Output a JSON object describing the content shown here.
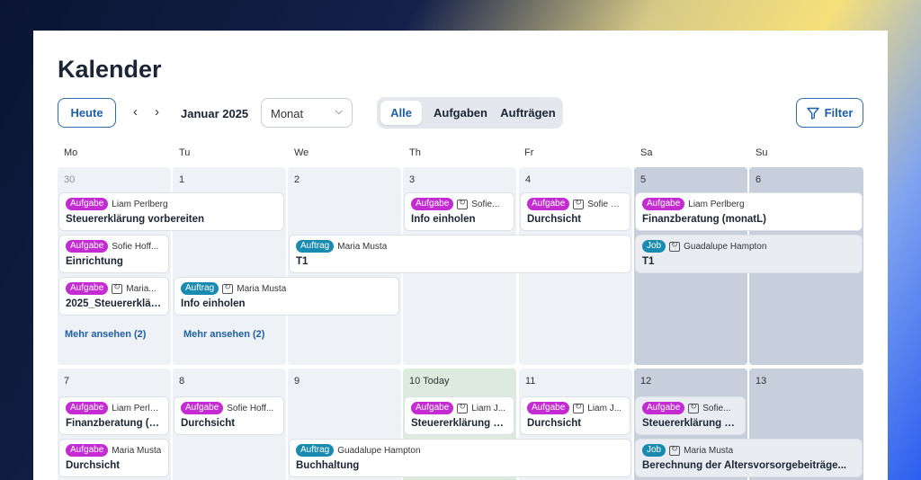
{
  "page": {
    "title": "Kalender"
  },
  "toolbar": {
    "today": "Heute",
    "prev": "‹",
    "next": "›",
    "month": "Januar 2025",
    "view": "Monat",
    "segments": [
      "Alle",
      "Aufgaben",
      "Aufträgen"
    ],
    "filter": "Filter"
  },
  "days": [
    "Mo",
    "Tu",
    "We",
    "Th",
    "Fr",
    "Sa",
    "Su"
  ],
  "week1": {
    "dates": [
      "30",
      "1",
      "2",
      "3",
      "4",
      "5",
      "6"
    ],
    "events": [
      {
        "type": "Aufgabe",
        "person": "Liam Perlberg",
        "title": "Steuererklärung vorbereiten"
      },
      {
        "type": "Aufgabe",
        "person": "Sofie Hoff...",
        "title": "Einrichtung"
      },
      {
        "type": "Aufgabe",
        "person": "Maria...",
        "title": "2025_Steuererklär..."
      },
      {
        "type": "Auftrag",
        "person": "Maria Musta",
        "title": "Info einholen"
      },
      {
        "type": "Auftrag",
        "person": "Maria Musta",
        "title": "T1"
      },
      {
        "type": "Aufgabe",
        "person": "Sofie...",
        "title": "Info einholen"
      },
      {
        "type": "Aufgabe",
        "person": "Sofie H...",
        "title": "Durchsicht"
      },
      {
        "type": "Aufgabe",
        "person": "Liam Perlberg",
        "title": "Finanzberatung (monatL)"
      },
      {
        "type": "Job",
        "person": "Guadalupe Hampton",
        "title": "T1"
      }
    ],
    "more": [
      "Mehr ansehen (2)",
      "Mehr ansehen (2)"
    ]
  },
  "week2": {
    "dates": [
      "7",
      "8",
      "9",
      "10 Today",
      "11",
      "12",
      "13"
    ],
    "events": [
      {
        "type": "Aufgabe",
        "person": "Liam Perlb...",
        "title": "Finanzberatung (m..."
      },
      {
        "type": "Aufgabe",
        "person": "Maria Musta",
        "title": "Durchsicht"
      },
      {
        "type": "Aufgabe",
        "person": "Sofie Hoff...",
        "title": "Durchsicht"
      },
      {
        "type": "Auftrag",
        "person": "Guadalupe Hampton",
        "title": "Buchhaltung"
      },
      {
        "type": "Aufgabe",
        "person": "Liam J...",
        "title": "Steuererklärung vo..."
      },
      {
        "type": "Aufgabe",
        "person": "Liam J...",
        "title": "Durchsicht"
      },
      {
        "type": "Aufgabe",
        "person": "Sofie...",
        "title": "Steuererklärung vo..."
      },
      {
        "type": "Job",
        "person": "Maria Musta",
        "title": "Berechnung der Altersvorsorgebeiträge..."
      }
    ]
  },
  "colors": {
    "accent": "#1f5fa8",
    "aufgabe": "#c52bd3",
    "auftrag": "#1a8bb0",
    "weekend": "#c6cfdb",
    "today": "#dcebdd"
  }
}
